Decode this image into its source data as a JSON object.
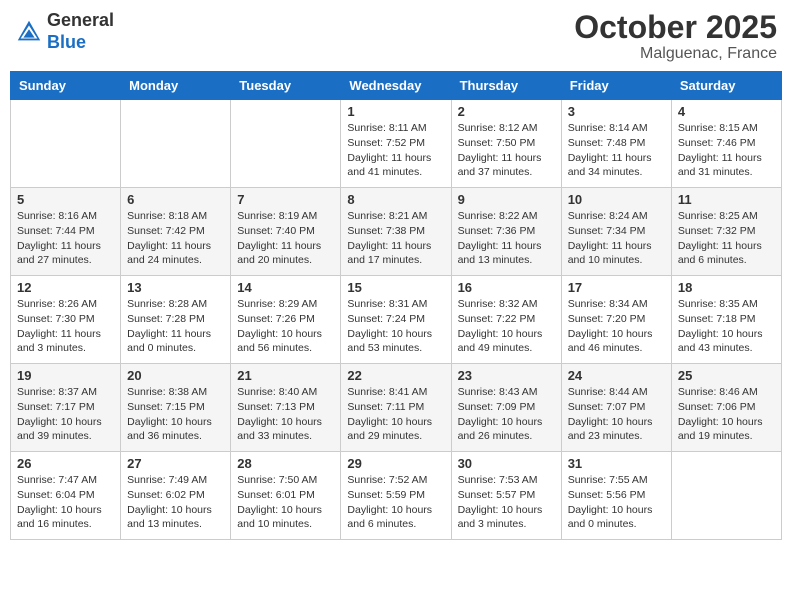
{
  "header": {
    "logo_general": "General",
    "logo_blue": "Blue",
    "month_title": "October 2025",
    "location": "Malguenac, France"
  },
  "days_of_week": [
    "Sunday",
    "Monday",
    "Tuesday",
    "Wednesday",
    "Thursday",
    "Friday",
    "Saturday"
  ],
  "weeks": [
    [
      {
        "day": "",
        "info": ""
      },
      {
        "day": "",
        "info": ""
      },
      {
        "day": "",
        "info": ""
      },
      {
        "day": "1",
        "info": "Sunrise: 8:11 AM\nSunset: 7:52 PM\nDaylight: 11 hours and 41 minutes."
      },
      {
        "day": "2",
        "info": "Sunrise: 8:12 AM\nSunset: 7:50 PM\nDaylight: 11 hours and 37 minutes."
      },
      {
        "day": "3",
        "info": "Sunrise: 8:14 AM\nSunset: 7:48 PM\nDaylight: 11 hours and 34 minutes."
      },
      {
        "day": "4",
        "info": "Sunrise: 8:15 AM\nSunset: 7:46 PM\nDaylight: 11 hours and 31 minutes."
      }
    ],
    [
      {
        "day": "5",
        "info": "Sunrise: 8:16 AM\nSunset: 7:44 PM\nDaylight: 11 hours and 27 minutes."
      },
      {
        "day": "6",
        "info": "Sunrise: 8:18 AM\nSunset: 7:42 PM\nDaylight: 11 hours and 24 minutes."
      },
      {
        "day": "7",
        "info": "Sunrise: 8:19 AM\nSunset: 7:40 PM\nDaylight: 11 hours and 20 minutes."
      },
      {
        "day": "8",
        "info": "Sunrise: 8:21 AM\nSunset: 7:38 PM\nDaylight: 11 hours and 17 minutes."
      },
      {
        "day": "9",
        "info": "Sunrise: 8:22 AM\nSunset: 7:36 PM\nDaylight: 11 hours and 13 minutes."
      },
      {
        "day": "10",
        "info": "Sunrise: 8:24 AM\nSunset: 7:34 PM\nDaylight: 11 hours and 10 minutes."
      },
      {
        "day": "11",
        "info": "Sunrise: 8:25 AM\nSunset: 7:32 PM\nDaylight: 11 hours and 6 minutes."
      }
    ],
    [
      {
        "day": "12",
        "info": "Sunrise: 8:26 AM\nSunset: 7:30 PM\nDaylight: 11 hours and 3 minutes."
      },
      {
        "day": "13",
        "info": "Sunrise: 8:28 AM\nSunset: 7:28 PM\nDaylight: 11 hours and 0 minutes."
      },
      {
        "day": "14",
        "info": "Sunrise: 8:29 AM\nSunset: 7:26 PM\nDaylight: 10 hours and 56 minutes."
      },
      {
        "day": "15",
        "info": "Sunrise: 8:31 AM\nSunset: 7:24 PM\nDaylight: 10 hours and 53 minutes."
      },
      {
        "day": "16",
        "info": "Sunrise: 8:32 AM\nSunset: 7:22 PM\nDaylight: 10 hours and 49 minutes."
      },
      {
        "day": "17",
        "info": "Sunrise: 8:34 AM\nSunset: 7:20 PM\nDaylight: 10 hours and 46 minutes."
      },
      {
        "day": "18",
        "info": "Sunrise: 8:35 AM\nSunset: 7:18 PM\nDaylight: 10 hours and 43 minutes."
      }
    ],
    [
      {
        "day": "19",
        "info": "Sunrise: 8:37 AM\nSunset: 7:17 PM\nDaylight: 10 hours and 39 minutes."
      },
      {
        "day": "20",
        "info": "Sunrise: 8:38 AM\nSunset: 7:15 PM\nDaylight: 10 hours and 36 minutes."
      },
      {
        "day": "21",
        "info": "Sunrise: 8:40 AM\nSunset: 7:13 PM\nDaylight: 10 hours and 33 minutes."
      },
      {
        "day": "22",
        "info": "Sunrise: 8:41 AM\nSunset: 7:11 PM\nDaylight: 10 hours and 29 minutes."
      },
      {
        "day": "23",
        "info": "Sunrise: 8:43 AM\nSunset: 7:09 PM\nDaylight: 10 hours and 26 minutes."
      },
      {
        "day": "24",
        "info": "Sunrise: 8:44 AM\nSunset: 7:07 PM\nDaylight: 10 hours and 23 minutes."
      },
      {
        "day": "25",
        "info": "Sunrise: 8:46 AM\nSunset: 7:06 PM\nDaylight: 10 hours and 19 minutes."
      }
    ],
    [
      {
        "day": "26",
        "info": "Sunrise: 7:47 AM\nSunset: 6:04 PM\nDaylight: 10 hours and 16 minutes."
      },
      {
        "day": "27",
        "info": "Sunrise: 7:49 AM\nSunset: 6:02 PM\nDaylight: 10 hours and 13 minutes."
      },
      {
        "day": "28",
        "info": "Sunrise: 7:50 AM\nSunset: 6:01 PM\nDaylight: 10 hours and 10 minutes."
      },
      {
        "day": "29",
        "info": "Sunrise: 7:52 AM\nSunset: 5:59 PM\nDaylight: 10 hours and 6 minutes."
      },
      {
        "day": "30",
        "info": "Sunrise: 7:53 AM\nSunset: 5:57 PM\nDaylight: 10 hours and 3 minutes."
      },
      {
        "day": "31",
        "info": "Sunrise: 7:55 AM\nSunset: 5:56 PM\nDaylight: 10 hours and 0 minutes."
      },
      {
        "day": "",
        "info": ""
      }
    ]
  ]
}
